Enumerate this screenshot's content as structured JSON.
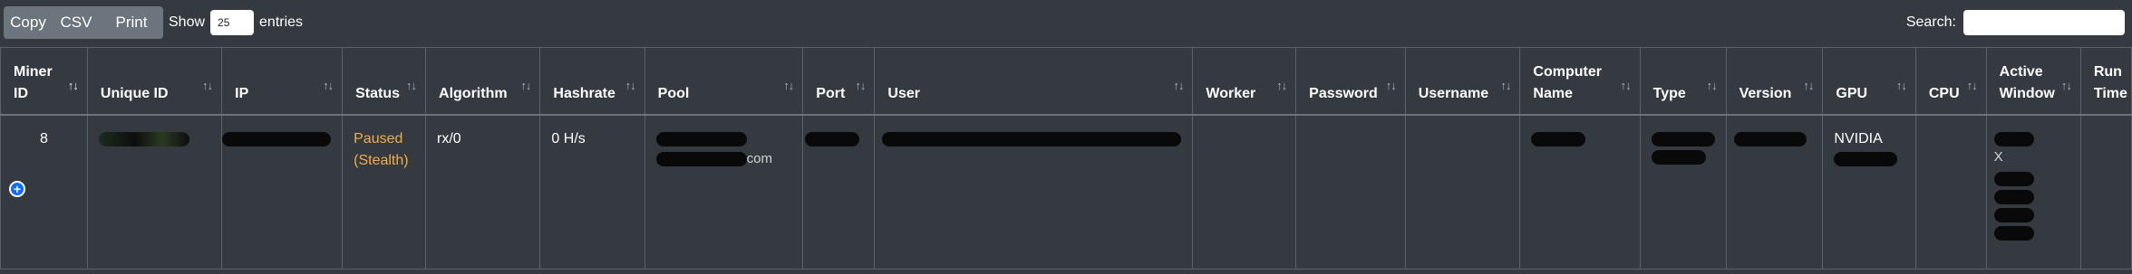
{
  "toolbar": {
    "buttons": [
      {
        "label": "Copy"
      },
      {
        "label": "CSV"
      },
      {
        "label": "Print"
      }
    ],
    "length": {
      "prefix": "Show",
      "value": "25",
      "suffix": "entries"
    },
    "search": {
      "label": "Search:",
      "value": ""
    }
  },
  "table": {
    "columns": [
      {
        "line1": "Miner",
        "line2": "ID"
      },
      {
        "line1": "",
        "line2": "Unique ID"
      },
      {
        "line1": "",
        "line2": "IP"
      },
      {
        "line1": "",
        "line2": "Status"
      },
      {
        "line1": "",
        "line2": "Algorithm"
      },
      {
        "line1": "",
        "line2": "Hashrate"
      },
      {
        "line1": "",
        "line2": "Pool"
      },
      {
        "line1": "",
        "line2": "Port"
      },
      {
        "line1": "",
        "line2": "User"
      },
      {
        "line1": "",
        "line2": "Worker"
      },
      {
        "line1": "",
        "line2": "Password"
      },
      {
        "line1": "",
        "line2": "Username"
      },
      {
        "line1": "Computer",
        "line2": "Name"
      },
      {
        "line1": "",
        "line2": "Type"
      },
      {
        "line1": "",
        "line2": "Version"
      },
      {
        "line1": "",
        "line2": "GPU"
      },
      {
        "line1": "",
        "line2": "CPU"
      },
      {
        "line1": "Active",
        "line2": "Window"
      },
      {
        "line1": "Run",
        "line2": "Time"
      }
    ],
    "rows": [
      {
        "miner_id": "8",
        "status_line1": "Paused",
        "status_line2": "(Stealth)",
        "algorithm": "rx/0",
        "hashrate": "0 H/s",
        "pool_tail": "com",
        "gpu": "NVIDIA",
        "active_window_tail": "X"
      }
    ]
  },
  "colors": {
    "background": "#343a40",
    "button": "#6c757d",
    "status_paused": "#f0ad4e",
    "expand_button": "#0d6efd"
  },
  "icons": [
    "sort-icon",
    "sort-asc-icon",
    "expand-row-icon"
  ]
}
